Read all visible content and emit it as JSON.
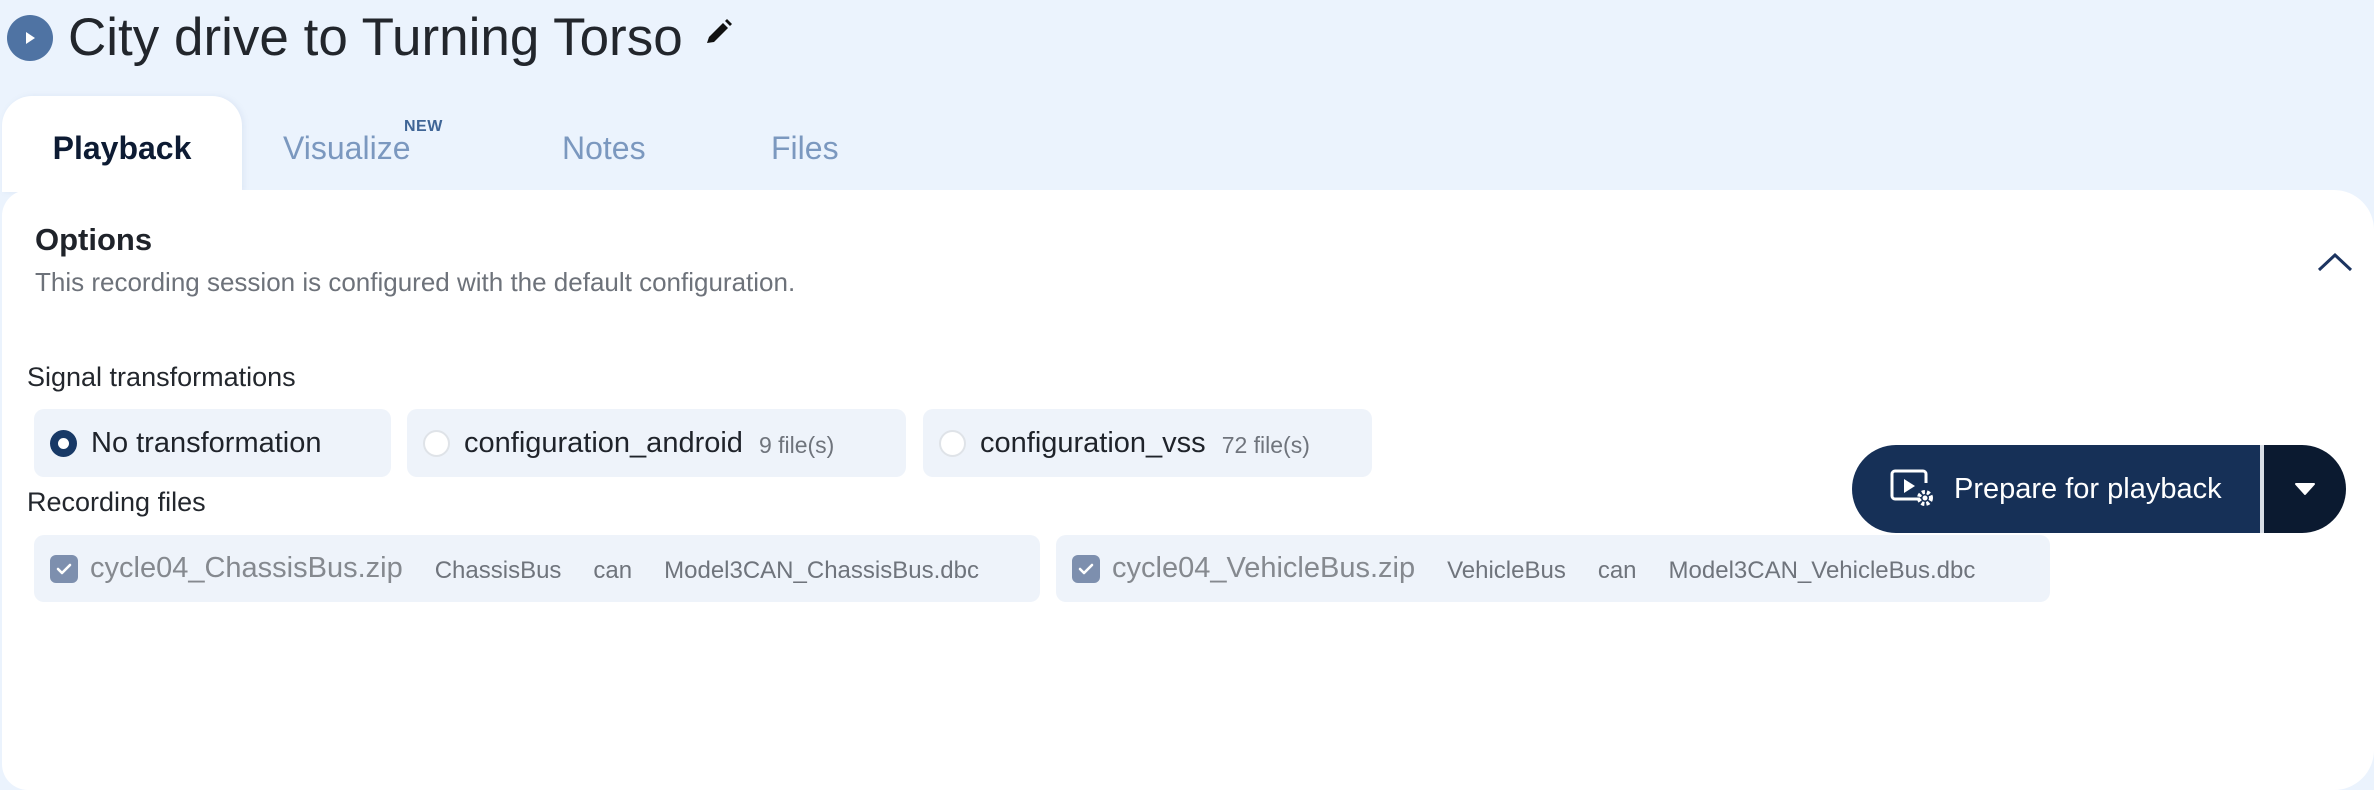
{
  "header": {
    "title": "City drive to Turning Torso",
    "icon": "play-circle-icon",
    "edit_icon": "pencil-icon"
  },
  "tabs": [
    {
      "label": "Playback",
      "active": true
    },
    {
      "label": "Visualize",
      "badge": "NEW",
      "active": false
    },
    {
      "label": "Notes",
      "active": false
    },
    {
      "label": "Files",
      "active": false
    }
  ],
  "options": {
    "title": "Options",
    "description": "This recording session is configured with the default configuration.",
    "collapse_icon": "chevron-up-icon"
  },
  "signal_transformations": {
    "label": "Signal transformations",
    "items": [
      {
        "label": "No transformation",
        "count": "",
        "selected": true
      },
      {
        "label": "configuration_android",
        "count": "9 file(s)",
        "selected": false
      },
      {
        "label": "configuration_vss",
        "count": "72 file(s)",
        "selected": false
      }
    ]
  },
  "recording_files": {
    "label": "Recording files",
    "items": [
      {
        "name": "cycle04_ChassisBus.zip",
        "bus": "ChassisBus",
        "protocol": "can",
        "dbc": "Model3CAN_ChassisBus.dbc",
        "checked": true
      },
      {
        "name": "cycle04_VehicleBus.zip",
        "bus": "VehicleBus",
        "protocol": "can",
        "dbc": "Model3CAN_VehicleBus.dbc",
        "checked": true
      }
    ]
  },
  "actions": {
    "prepare_label": "Prepare for playback",
    "prepare_icon": "video-settings-icon",
    "dropdown_icon": "caret-down-icon"
  },
  "colors": {
    "page_bg": "#ebf3fd",
    "primary_navy": "#163057",
    "dropdown_navy": "#0b1a30",
    "tab_inactive": "#7b98bf",
    "badge": "#3f6596",
    "option_bg": "#eef3fa",
    "checkbox": "#7d8fae"
  }
}
